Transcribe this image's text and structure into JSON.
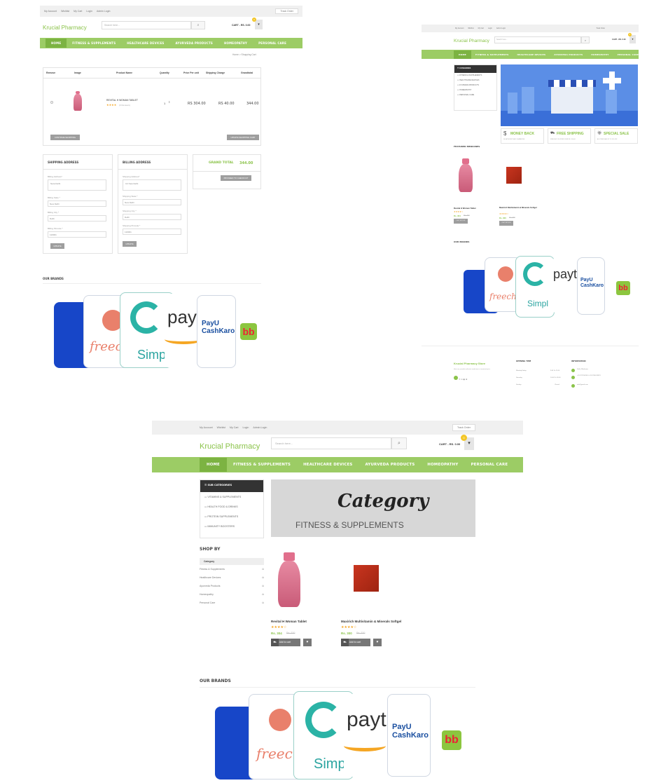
{
  "topbar": {
    "my_account": "My Account",
    "wishlist": "Wishlist",
    "my_cart": "My Cart",
    "login": "Login",
    "admin_login": "Admin Login",
    "track_order": "Track Order"
  },
  "logo": "Krucial Pharmacy",
  "search_placeholder": "Search here...",
  "cart_label": "CART - RS. 0.00",
  "cart_count": "0",
  "nav": [
    "HOME",
    "FITNESS & SUPPLEMENTS",
    "HEALTHCARE DEVICES",
    "AYURVEDA PRODUCTS",
    "HOMEOPATHY",
    "PERSONAL CARE"
  ],
  "cart_page": {
    "breadcrumb": "Home  >  Shopping Cart",
    "columns": [
      "Remove",
      "Image",
      "Product Name",
      "Quantity",
      "Price Per unit",
      "Shipping Charge",
      "Grandtotal"
    ],
    "row": {
      "name": "REVITAL H WOMAN TABLET",
      "reviews": "(0 Reviews)",
      "qty": "1",
      "price": "RS 304.00",
      "shipping": "RS 40.00",
      "total": "344.00"
    },
    "continue_shopping": "CONTINUE SHOPPING",
    "update_cart": "UPDATE SHOPPING CART",
    "shipping_title": "SHIPPING ADDRESS",
    "billing_title": "BILLING ADDRESS",
    "shipping_fields": [
      {
        "label": "Billing Address*",
        "value": "Nara Delhi"
      },
      {
        "label": "Billing State *",
        "value": "New Delhi"
      },
      {
        "label": "Billing City *",
        "value": "Delhi"
      },
      {
        "label": "Billing Pincode *",
        "value": "110001"
      }
    ],
    "billing_fields": [
      {
        "label": "Shipping Address*",
        "value": "C2 New Delhi"
      },
      {
        "label": "Shipping State *",
        "value": "New Delhi"
      },
      {
        "label": "Shipping City *",
        "value": "Delhi"
      },
      {
        "label": "Shipping Pincode *",
        "value": "110001"
      }
    ],
    "update_btn": "UPDATE",
    "grand_total_label": "GRAND TOTAL",
    "grand_total_value": "344.00",
    "proceed": "PROCEED TO CHECKOUT",
    "our_brands": "OUR BRANDS"
  },
  "home_page": {
    "categories_title": "CATEGORIES",
    "categories": [
      "FITNESS & SUPPLEMENTS",
      "HEALTHCARE DEVICES",
      "AYURVEDA PRODUCTS",
      "HOMEOPATHY",
      "PERSONAL CARE"
    ],
    "features": [
      {
        "title": "MONEY BACK",
        "sub": "30 DAY MONEY BACK GUARANTEE",
        "icon": "dollar-icon"
      },
      {
        "title": "FREE SHIPPING",
        "sub": "FREE SHIP ON ORDER OVER RS. 1000.00",
        "icon": "truck-icon"
      },
      {
        "title": "SPECIAL SALE",
        "sub": "ALL ITEMS SALE UP TO 20% OFF",
        "icon": "gift-icon"
      }
    ],
    "featured_title": "FEATURED MEDICINES",
    "products": [
      {
        "name": "Revital H Woman Tablet",
        "price": "Rs. 304",
        "old": "Rs. 320",
        "btn": "OUT STOCK"
      },
      {
        "name": "Maxirich Multivitamin & Minerals Softgel",
        "price": "Rs. 300",
        "old": "Rs. 320",
        "btn": "OUT STOCK"
      }
    ],
    "our_brands": "OUR BRANDS",
    "footer": {
      "store_title": "Krucial Pharmacy Store",
      "store_text": "Here we provide authentic medicines at nominal price",
      "opening_title": "OPENING TIME",
      "hours": [
        {
          "day": "Monday-Friday",
          "time": "9:00 To 21:00"
        },
        {
          "day": "Saturday",
          "time": "10:00 To 18:00"
        },
        {
          "day": "Sunday",
          "time": "Closed"
        }
      ],
      "info_title": "INFORMATION",
      "info": [
        "Delhi, Bhalaswa",
        "+91 9717002414 +91 8750013323",
        "info@gmail.com"
      ]
    }
  },
  "category_page": {
    "sub_title": "SUB CATEGORIES",
    "subs": [
      "VITAMINS & SUPPLEMENTS",
      "HEALTH FOOD & DRINKS",
      "PROTEIN SUPPLEMENTS",
      "IMMUNITY BOOSTERS"
    ],
    "banner_title": "Category",
    "banner_sub": "FITNESS & SUPPLEMENTS",
    "shop_by": "SHOP BY",
    "filter_title": "Category",
    "filters": [
      "Fitness & Supplements",
      "Healthcare Devices",
      "Ayurveda Products",
      "Homeopathy",
      "Personal Care"
    ],
    "products": [
      {
        "name": "Revital H Woman Tablet",
        "price": "Rs. 304",
        "old": "Rs. 320",
        "btn": "Add to cart"
      },
      {
        "name": "Maxirich Multivitamin & Minerals Softgel",
        "price": "Rs. 300",
        "old": "Rs. 320",
        "btn": "Add to cart"
      }
    ],
    "our_brands": "OUR BRANDS"
  },
  "brands": [
    "freecharge",
    "Simpl",
    "paytm",
    "PayU CashKaro",
    "bb"
  ],
  "colors": {
    "brand_green": "#8bc34a",
    "nav_green": "#9ccc65",
    "badge_yellow": "#f3c626"
  }
}
